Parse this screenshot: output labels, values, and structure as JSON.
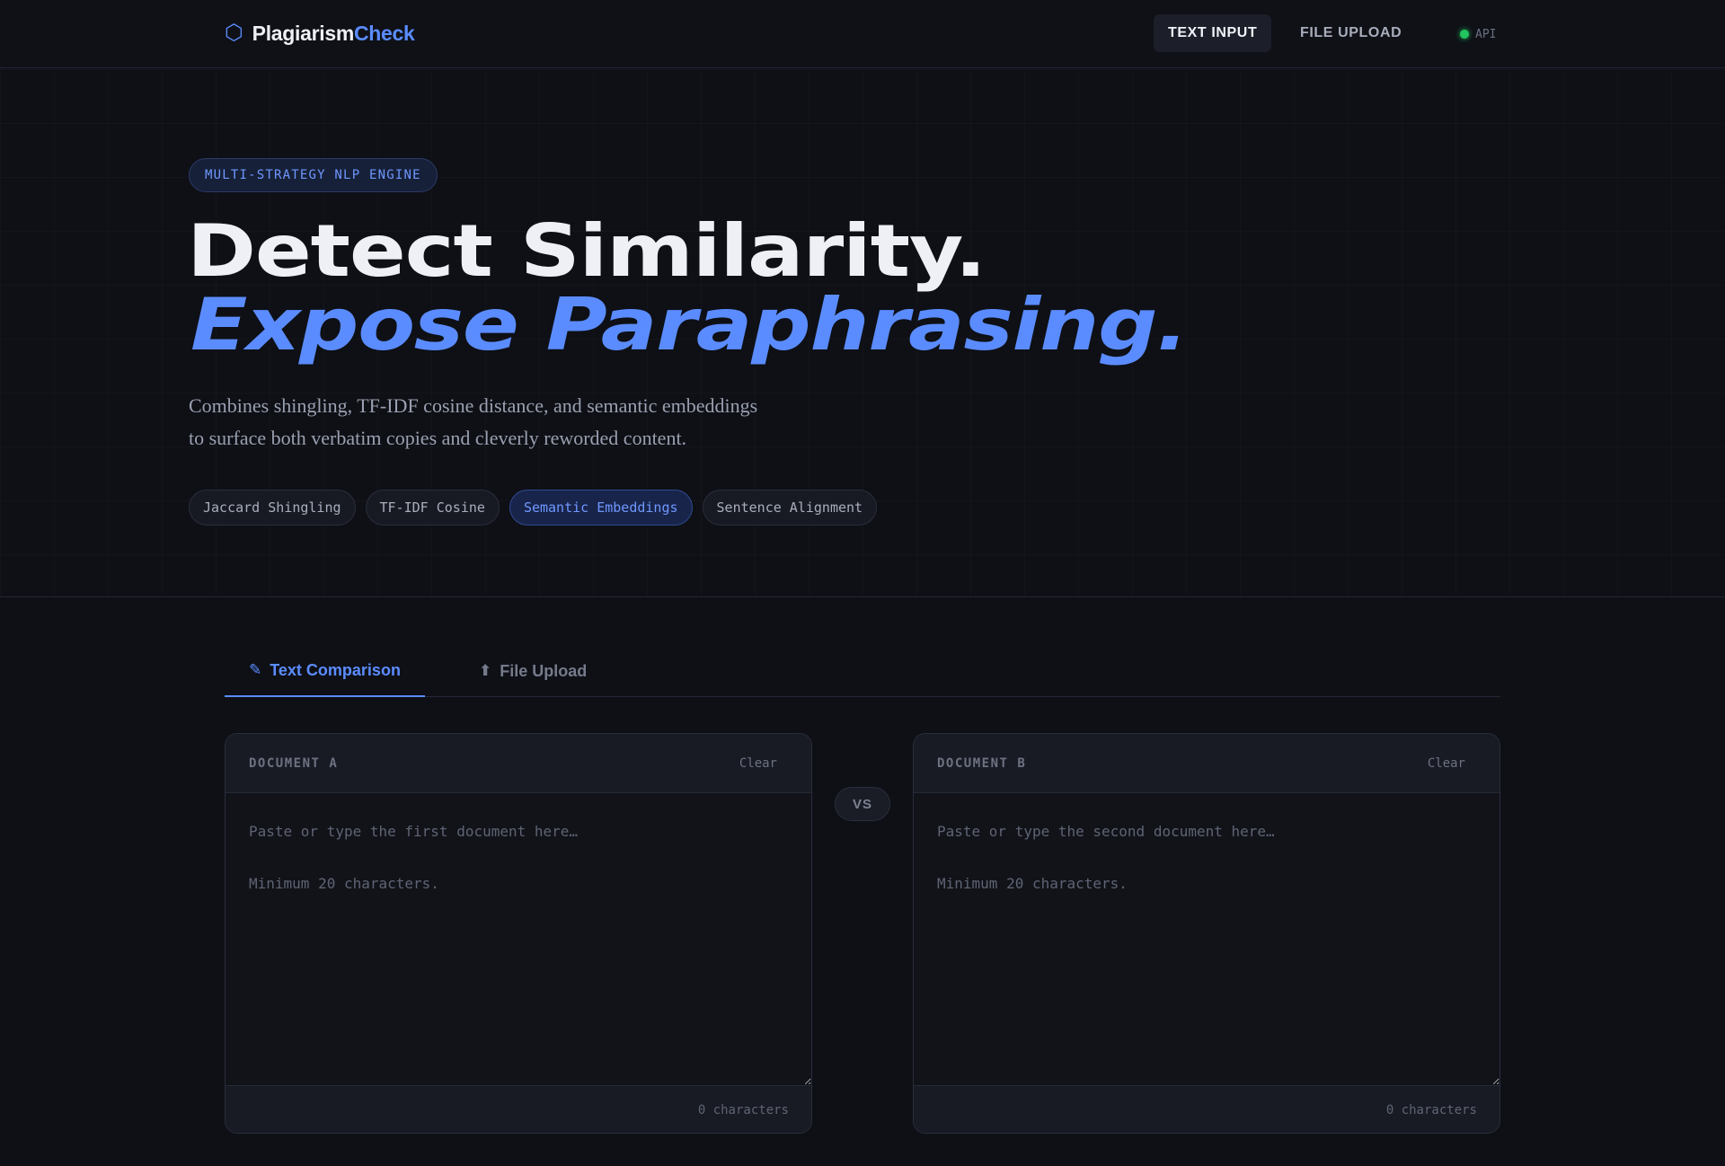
{
  "nav": {
    "logo_part1": "Plagiarism",
    "logo_part2": "Check",
    "logo_icon": "hexagon-icon",
    "items": [
      {
        "label": "TEXT INPUT",
        "active": true
      },
      {
        "label": "FILE UPLOAD",
        "active": false
      }
    ],
    "api_label": "API",
    "api_status_color": "#22c55e"
  },
  "hero": {
    "eyebrow": "MULTI-STRATEGY NLP ENGINE",
    "headline_line1": "Detect Similarity.",
    "headline_line2": "Expose Paraphrasing.",
    "subtitle_line1": "Combines shingling, TF-IDF cosine distance, and semantic embeddings",
    "subtitle_line2": "to surface both verbatim copies and cleverly reworded content.",
    "chips": [
      {
        "label": "Jaccard Shingling",
        "highlighted": false
      },
      {
        "label": "TF-IDF Cosine",
        "highlighted": false
      },
      {
        "label": "Semantic Embeddings",
        "highlighted": true
      },
      {
        "label": "Sentence Alignment",
        "highlighted": false
      }
    ]
  },
  "tabs": [
    {
      "label": "Text Comparison",
      "icon": "pencil-icon",
      "active": true
    },
    {
      "label": "File Upload",
      "icon": "upload-arrow-icon",
      "active": false
    }
  ],
  "docA": {
    "label": "DOCUMENT A",
    "clear_label": "Clear",
    "placeholder": "Paste or type the first document here…\n\nMinimum 20 characters.",
    "char_count": "0 characters"
  },
  "docB": {
    "label": "DOCUMENT B",
    "clear_label": "Clear",
    "placeholder": "Paste or type the second document here…\n\nMinimum 20 characters.",
    "char_count": "0 characters"
  },
  "vs_label": "VS",
  "colors": {
    "accent": "#5b8cff",
    "background": "#0e1016",
    "panel": "#181b24"
  }
}
